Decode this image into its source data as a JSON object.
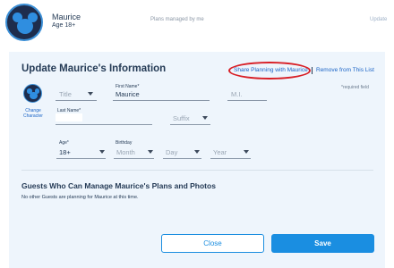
{
  "header": {
    "name": "Maurice",
    "age": "Age 18+",
    "plans_label": "Plans managed by me",
    "update_label": "Update"
  },
  "form": {
    "title": "Update Maurice's Information",
    "share_link": "Share Planning with Maurice",
    "remove_link": "Remove from This List",
    "required_note": "*required field",
    "change_character": "Change Character",
    "title_field": {
      "placeholder": "Title"
    },
    "first_name": {
      "label": "First Name*",
      "value": "Maurice"
    },
    "middle_initial": {
      "placeholder": "M.I."
    },
    "last_name": {
      "label": "Last Name*",
      "value": ""
    },
    "suffix": {
      "placeholder": "Suffix"
    },
    "age": {
      "label": "Age*",
      "value": "18+"
    },
    "birthday": {
      "label": "Birthday",
      "month": "Month",
      "day": "Day",
      "year": "Year"
    }
  },
  "guests": {
    "title": "Guests Who Can Manage Maurice's Plans and Photos",
    "note": "No other Guests are planning for Maurice at this time."
  },
  "buttons": {
    "close": "Close",
    "save": "Save"
  },
  "colors": {
    "accent": "#1a8ee1",
    "link": "#1b64c6",
    "highlight": "#d81f26",
    "panel_bg": "#eef5fc"
  }
}
